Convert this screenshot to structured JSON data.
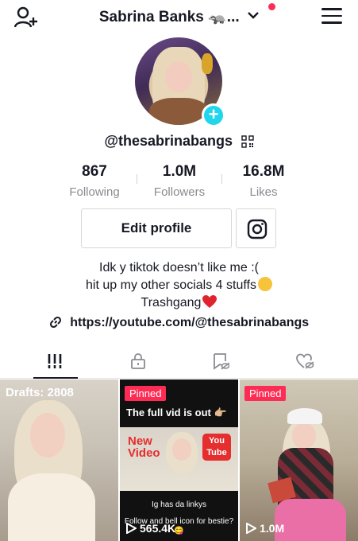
{
  "header": {
    "display_name": "Sabrina Banks 🦡...",
    "has_notification_dot": true
  },
  "profile": {
    "handle": "@thesabrinabangs",
    "stats": [
      {
        "value": "867",
        "label": "Following"
      },
      {
        "value": "1.0M",
        "label": "Followers"
      },
      {
        "value": "16.8M",
        "label": "Likes"
      }
    ],
    "edit_button_label": "Edit profile",
    "bio_lines": [
      "Idk y tiktok doesn’t like me :(",
      "hit up my other socials 4 stuffs",
      "Trashgang"
    ],
    "link": "https://youtube.com/@thesabrinabangs"
  },
  "tabs": [
    "videos-grid",
    "private",
    "favorites",
    "liked"
  ],
  "videos": [
    {
      "overlay": "Drafts: 2808"
    },
    {
      "badge": "Pinned",
      "caption": "The full vid is out 👉🏼",
      "banner_left": "New Video",
      "banner_right": "You Tube",
      "subtext_1": "Ig has da linkys",
      "subtext_2": "Follow and bell icon for bestie?😋",
      "views": "565.4K"
    },
    {
      "badge": "Pinned",
      "views": "1.0M"
    }
  ],
  "colors": {
    "accent_pink": "#fe2c55",
    "add_badge": "#20d5ec",
    "muted_text": "#8a8b91"
  }
}
